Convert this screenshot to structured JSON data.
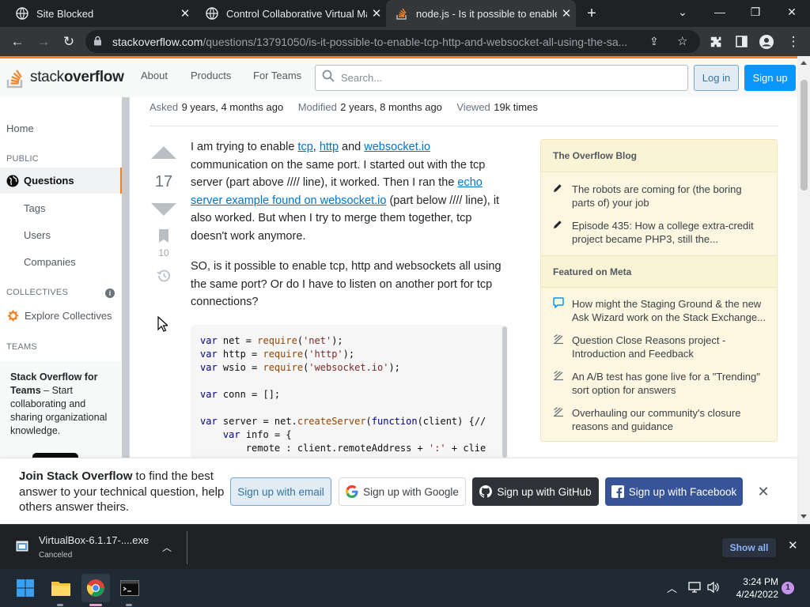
{
  "tabs": [
    {
      "title": "Site Blocked",
      "favicon": "globe-icon",
      "active": false
    },
    {
      "title": "Control Collaborative Virtual Mac",
      "favicon": "globe-icon",
      "active": false
    },
    {
      "title": "node.js - Is it possible to enable t",
      "favicon": "stackoverflow-icon",
      "active": true
    }
  ],
  "browser": {
    "url_host": "stackoverflow.com",
    "url_path": "/questions/13791050/is-it-possible-to-enable-tcp-http-and-websocket-all-using-the-sa..."
  },
  "header": {
    "logo_text_light": "stack",
    "logo_text_bold": "overflow",
    "nav": [
      "About",
      "Products",
      "For Teams"
    ],
    "search_placeholder": "Search...",
    "login": "Log in",
    "signup": "Sign up"
  },
  "leftnav": {
    "home": "Home",
    "public": "PUBLIC",
    "questions": "Questions",
    "tags": "Tags",
    "users": "Users",
    "companies": "Companies",
    "collectives": "COLLECTIVES",
    "explore_collectives": "Explore Collectives",
    "teams": "TEAMS",
    "teams_title": "Stack Overflow for Teams",
    "teams_desc": " – Start collaborating and sharing organizational knowledge."
  },
  "meta": {
    "asked_label": "Asked",
    "asked_value": "9 years, 4 months ago",
    "modified_label": "Modified",
    "modified_value": "2 years, 8 months ago",
    "viewed_label": "Viewed",
    "viewed_value": "19k times"
  },
  "post": {
    "votes": "17",
    "bookmarks": "10",
    "p1_a": "I am trying to enable ",
    "p1_link1": "tcp",
    "p1_b": ", ",
    "p1_link2": "http",
    "p1_c": " and ",
    "p1_link3": "websocket.io",
    "p1_d": " communication on the same port. I started out with the tcp server (part above //// line), it worked. Then I ran the ",
    "p1_link4": "echo server example found on websocket.io",
    "p1_e": " (part below //// line), it also worked. But when I try to merge them together, tcp doesn't work anymore.",
    "p2": "SO, is it possible to enable tcp, http and websockets all using the same port? Or do I have to listen on another port for tcp connections?"
  },
  "code": {
    "l1_a": "var",
    "l1_b": " net = ",
    "l1_c": "require",
    "l1_d": "(",
    "l1_e": "'net'",
    "l1_f": ");",
    "l2_a": "var",
    "l2_b": " http = ",
    "l2_c": "require",
    "l2_d": "(",
    "l2_e": "'http'",
    "l2_f": ");",
    "l3_a": "var",
    "l3_b": " wsio = ",
    "l3_c": "require",
    "l3_d": "(",
    "l3_e": "'websocket.io'",
    "l3_f": ");",
    "l5_a": "var",
    "l5_b": " conn = [];",
    "l7_a": "var",
    "l7_b": " server = net.",
    "l7_c": "createServer",
    "l7_d": "(",
    "l7_e": "function",
    "l7_f": "(client) {//",
    "l8_a": "    ",
    "l8_b": "var",
    "l8_c": " info = {",
    "l9": "        remote : client.remoteAddress + ",
    "l9_str": "':'",
    "l9_end": " + clie"
  },
  "widget": {
    "blog_title": "The Overflow Blog",
    "blog_items": [
      "The robots are coming for (the boring parts of) your job",
      "Episode 435: How a college extra-credit project became PHP3, still the..."
    ],
    "meta_title": "Featured on Meta",
    "meta_items": [
      "How might the Staging Ground & the new Ask Wizard work on the Stack Exchange...",
      "Question Close Reasons project - Introduction and Feedback",
      "An A/B test has gone live for a \"Trending\" sort option for answers",
      "Overhauling our community's closure reasons and guidance"
    ]
  },
  "signup_bar": {
    "bold": "Join Stack Overflow",
    "rest": " to find the best answer to your technical question, help others answer theirs.",
    "email": "Sign up with email",
    "google": "Sign up with Google",
    "github": "Sign up with GitHub",
    "facebook": "Sign up with Facebook"
  },
  "download": {
    "filename": "VirtualBox-6.1.17-....exe",
    "status": "Canceled",
    "show_all": "Show all"
  },
  "taskbar": {
    "time": "3:24 PM",
    "date": "4/24/2022",
    "badge": "1"
  },
  "colors": {
    "so_orange": "#f48225",
    "so_blue": "#0a95ff",
    "github_dark": "#2f3337",
    "facebook_blue": "#385499"
  }
}
